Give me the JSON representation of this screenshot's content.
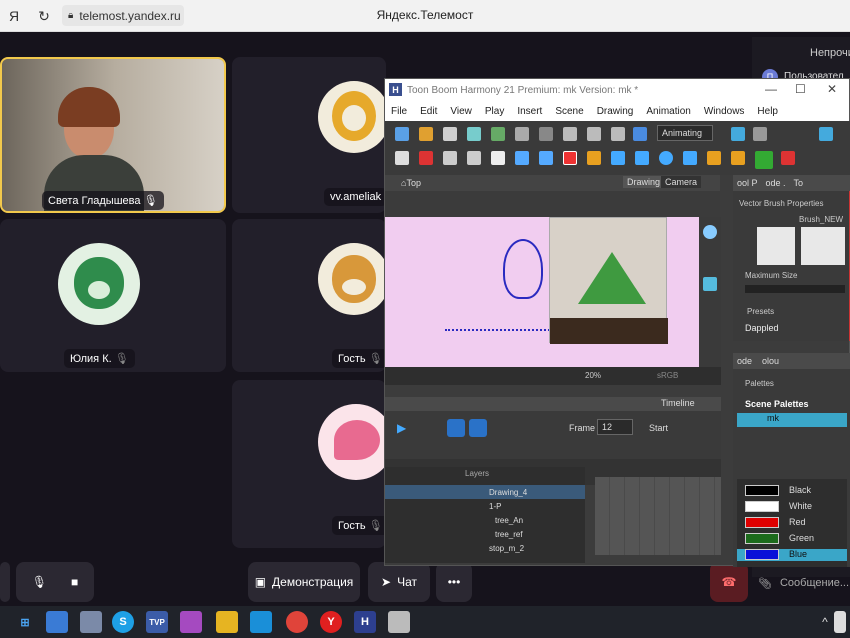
{
  "browser": {
    "url": "telemost.yandex.ru",
    "title": "Яндекс.Телемост"
  },
  "participants": [
    {
      "name": "Света Гладышева"
    },
    {
      "name": "vv.ameliak"
    },
    {
      "name": "Юлия К."
    },
    {
      "name": "Гость"
    },
    {
      "name": "Гость"
    }
  ],
  "side": {
    "status": "Непрочи",
    "user_initial": "П",
    "user": "Пользовател",
    "message_placeholder": "Сообщение..."
  },
  "controls": {
    "demo": "Демонстрация",
    "chat": "Чат",
    "more": "•••"
  },
  "toonboom": {
    "title": "Toon Boom Harmony 21 Premium: mk Version: mk *",
    "menu": [
      "File",
      "Edit",
      "View",
      "Play",
      "Insert",
      "Scene",
      "Drawing",
      "Animation",
      "Windows",
      "Help"
    ],
    "mode": "Animating",
    "view_tabs": [
      "Drawing",
      "Camera"
    ],
    "view_top": "Top",
    "zoom": "20%",
    "color_space": "sRGB",
    "props_tabs": [
      "ool P",
      "ode .",
      "To"
    ],
    "brush_props": "Vector Brush Properties",
    "brush_name": "Brush_NEW",
    "max_size": "Maximum Size",
    "presets": "Presets",
    "preset_item": "Dappled",
    "palette_tabs": [
      "ode",
      "olou"
    ],
    "palettes_label": "Palettes",
    "scene_palettes": "Scene Palettes",
    "palette_item": "mk",
    "timeline": "Timeline",
    "frame_label": "Frame",
    "frame_value": "12",
    "start_label": "Start",
    "layers_label": "Layers",
    "layers": [
      "Drawing_4",
      "1-P",
      "tree_An",
      "tree_ref",
      "stop_m_2"
    ],
    "colors": [
      {
        "name": "Black",
        "hex": "#000000"
      },
      {
        "name": "White",
        "hex": "#ffffff"
      },
      {
        "name": "Red",
        "hex": "#e00000"
      },
      {
        "name": "Green",
        "hex": "#1c6b1c"
      },
      {
        "name": "Blue",
        "hex": "#0a10d8"
      }
    ]
  }
}
